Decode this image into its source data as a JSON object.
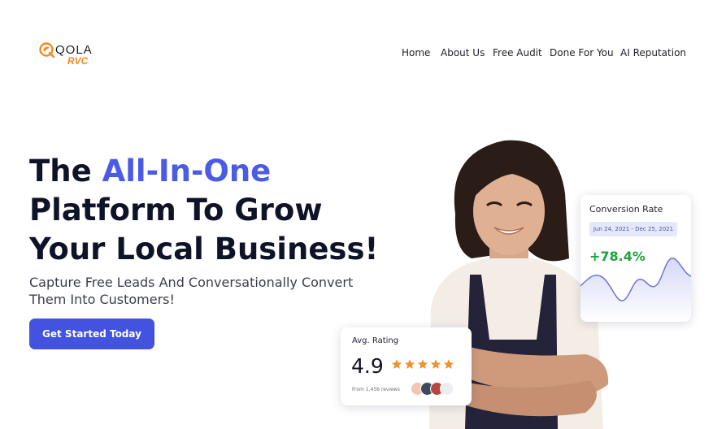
{
  "brand": {
    "name": "QOLA",
    "sub": "RVC",
    "accent_color": "#f08b1c"
  },
  "nav": {
    "items": [
      {
        "label": "Home"
      },
      {
        "label": "About Us"
      },
      {
        "label": "Free Audit"
      },
      {
        "label": "Done For You"
      },
      {
        "label": "AI Reputation"
      }
    ]
  },
  "hero": {
    "headline_part1": "The ",
    "headline_accent": "All-In-One",
    "headline_line2": "Platform To Grow",
    "headline_line3": "Your Local Business!",
    "subtext": "Capture Free Leads And Conversationally Convert Them Into Customers!",
    "cta_label": "Get Started Today",
    "accent_color": "#4a5be6",
    "cta_color": "#4353e0"
  },
  "conversion_card": {
    "title": "Conversion Rate",
    "date_range": "Jun 24, 2021 - Dec 25, 2021",
    "value": "+78.4%",
    "value_color": "#1ea33a",
    "line_color": "#6b72d8"
  },
  "rating_card": {
    "title": "Avg. Rating",
    "value": "4.9",
    "stars": 5,
    "reviews_text": "From 1,456 reviews",
    "star_color": "#f0922e"
  },
  "icons": {
    "logo": "qola-leaf-logo-icon",
    "star": "star-icon",
    "avatar": "reviewer-avatar-icon"
  }
}
